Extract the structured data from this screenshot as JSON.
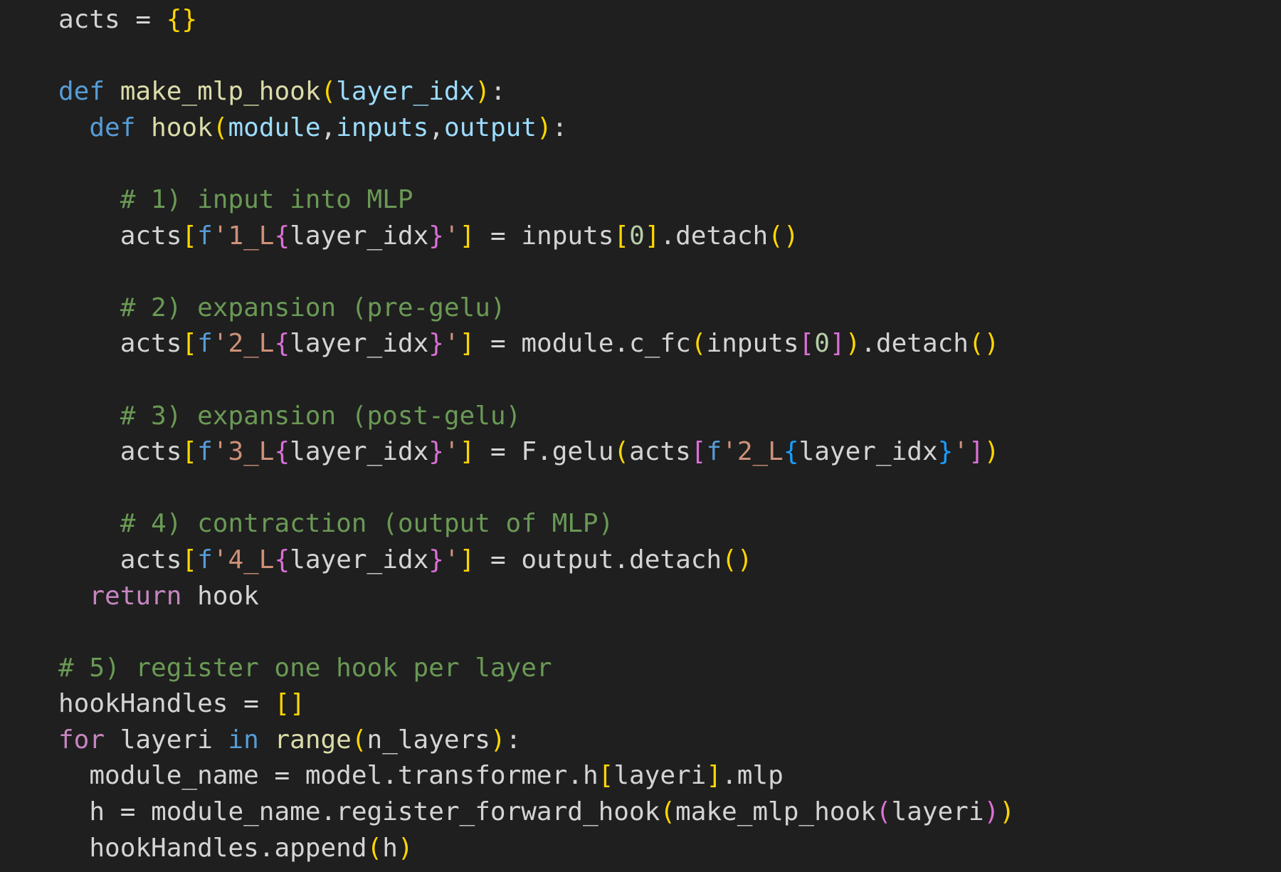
{
  "editor": {
    "language": "python",
    "theme_colors": {
      "background": "#1f1f1f",
      "keyword": "#569cd6",
      "control": "#c586c0",
      "function": "#dcdcaa",
      "parameter": "#9cdcfe",
      "comment": "#6a9955",
      "string": "#ce9178",
      "number": "#b5cea8",
      "bracket_level1": "#ffd700",
      "bracket_level2": "#da70d6",
      "bracket_level3": "#179fff"
    },
    "lines": [
      [
        {
          "t": "acts",
          "c": "var"
        },
        {
          "t": " = ",
          "c": "op"
        },
        {
          "t": "{}",
          "c": "br1"
        }
      ],
      [],
      [
        {
          "t": "def",
          "c": "kw"
        },
        {
          "t": " ",
          "c": "var"
        },
        {
          "t": "make_mlp_hook",
          "c": "fn"
        },
        {
          "t": "(",
          "c": "br1"
        },
        {
          "t": "layer_idx",
          "c": "param"
        },
        {
          "t": ")",
          "c": "br1"
        },
        {
          "t": ":",
          "c": "punc"
        }
      ],
      [
        {
          "t": "  ",
          "c": "var"
        },
        {
          "t": "def",
          "c": "kw"
        },
        {
          "t": " ",
          "c": "var"
        },
        {
          "t": "hook",
          "c": "fn"
        },
        {
          "t": "(",
          "c": "br1"
        },
        {
          "t": "module",
          "c": "param"
        },
        {
          "t": ",",
          "c": "punc"
        },
        {
          "t": "inputs",
          "c": "param"
        },
        {
          "t": ",",
          "c": "punc"
        },
        {
          "t": "output",
          "c": "param"
        },
        {
          "t": ")",
          "c": "br1"
        },
        {
          "t": ":",
          "c": "punc"
        }
      ],
      [],
      [
        {
          "t": "    ",
          "c": "var"
        },
        {
          "t": "# 1) input into MLP",
          "c": "comment"
        }
      ],
      [
        {
          "t": "    ",
          "c": "var"
        },
        {
          "t": "acts",
          "c": "var"
        },
        {
          "t": "[",
          "c": "br1"
        },
        {
          "t": "f",
          "c": "fpre"
        },
        {
          "t": "'1_L",
          "c": "str"
        },
        {
          "t": "{",
          "c": "br2"
        },
        {
          "t": "layer_idx",
          "c": "var"
        },
        {
          "t": "}",
          "c": "br2"
        },
        {
          "t": "'",
          "c": "str"
        },
        {
          "t": "]",
          "c": "br1"
        },
        {
          "t": " = ",
          "c": "op"
        },
        {
          "t": "inputs",
          "c": "var"
        },
        {
          "t": "[",
          "c": "br1"
        },
        {
          "t": "0",
          "c": "num"
        },
        {
          "t": "]",
          "c": "br1"
        },
        {
          "t": ".detach",
          "c": "var"
        },
        {
          "t": "()",
          "c": "br1"
        }
      ],
      [],
      [
        {
          "t": "    ",
          "c": "var"
        },
        {
          "t": "# 2) expansion (pre-gelu)",
          "c": "comment"
        }
      ],
      [
        {
          "t": "    ",
          "c": "var"
        },
        {
          "t": "acts",
          "c": "var"
        },
        {
          "t": "[",
          "c": "br1"
        },
        {
          "t": "f",
          "c": "fpre"
        },
        {
          "t": "'2_L",
          "c": "str"
        },
        {
          "t": "{",
          "c": "br2"
        },
        {
          "t": "layer_idx",
          "c": "var"
        },
        {
          "t": "}",
          "c": "br2"
        },
        {
          "t": "'",
          "c": "str"
        },
        {
          "t": "]",
          "c": "br1"
        },
        {
          "t": " = ",
          "c": "op"
        },
        {
          "t": "module.c_fc",
          "c": "var"
        },
        {
          "t": "(",
          "c": "br1"
        },
        {
          "t": "inputs",
          "c": "var"
        },
        {
          "t": "[",
          "c": "br2"
        },
        {
          "t": "0",
          "c": "num"
        },
        {
          "t": "]",
          "c": "br2"
        },
        {
          "t": ")",
          "c": "br1"
        },
        {
          "t": ".detach",
          "c": "var"
        },
        {
          "t": "()",
          "c": "br1"
        }
      ],
      [],
      [
        {
          "t": "    ",
          "c": "var"
        },
        {
          "t": "# 3) expansion (post-gelu)",
          "c": "comment"
        }
      ],
      [
        {
          "t": "    ",
          "c": "var"
        },
        {
          "t": "acts",
          "c": "var"
        },
        {
          "t": "[",
          "c": "br1"
        },
        {
          "t": "f",
          "c": "fpre"
        },
        {
          "t": "'3_L",
          "c": "str"
        },
        {
          "t": "{",
          "c": "br2"
        },
        {
          "t": "layer_idx",
          "c": "var"
        },
        {
          "t": "}",
          "c": "br2"
        },
        {
          "t": "'",
          "c": "str"
        },
        {
          "t": "]",
          "c": "br1"
        },
        {
          "t": " = ",
          "c": "op"
        },
        {
          "t": "F.gelu",
          "c": "var"
        },
        {
          "t": "(",
          "c": "br1"
        },
        {
          "t": "acts",
          "c": "var"
        },
        {
          "t": "[",
          "c": "br2"
        },
        {
          "t": "f",
          "c": "fpre"
        },
        {
          "t": "'2_L",
          "c": "str"
        },
        {
          "t": "{",
          "c": "br3"
        },
        {
          "t": "layer_idx",
          "c": "var"
        },
        {
          "t": "}",
          "c": "br3"
        },
        {
          "t": "'",
          "c": "str"
        },
        {
          "t": "]",
          "c": "br2"
        },
        {
          "t": ")",
          "c": "br1"
        }
      ],
      [],
      [
        {
          "t": "    ",
          "c": "var"
        },
        {
          "t": "# 4) contraction (output of MLP)",
          "c": "comment"
        }
      ],
      [
        {
          "t": "    ",
          "c": "var"
        },
        {
          "t": "acts",
          "c": "var"
        },
        {
          "t": "[",
          "c": "br1"
        },
        {
          "t": "f",
          "c": "fpre"
        },
        {
          "t": "'4_L",
          "c": "str"
        },
        {
          "t": "{",
          "c": "br2"
        },
        {
          "t": "layer_idx",
          "c": "var"
        },
        {
          "t": "}",
          "c": "br2"
        },
        {
          "t": "'",
          "c": "str"
        },
        {
          "t": "]",
          "c": "br1"
        },
        {
          "t": " = ",
          "c": "op"
        },
        {
          "t": "output.detach",
          "c": "var"
        },
        {
          "t": "()",
          "c": "br1"
        }
      ],
      [
        {
          "t": "  ",
          "c": "var"
        },
        {
          "t": "return",
          "c": "ctl"
        },
        {
          "t": " hook",
          "c": "var"
        }
      ],
      [],
      [
        {
          "t": "# 5) register one hook per layer",
          "c": "comment"
        }
      ],
      [
        {
          "t": "hookHandles",
          "c": "var"
        },
        {
          "t": " = ",
          "c": "op"
        },
        {
          "t": "[]",
          "c": "br1"
        }
      ],
      [
        {
          "t": "for",
          "c": "ctl"
        },
        {
          "t": " layeri ",
          "c": "var"
        },
        {
          "t": "in",
          "c": "kw"
        },
        {
          "t": " ",
          "c": "var"
        },
        {
          "t": "range",
          "c": "fn"
        },
        {
          "t": "(",
          "c": "br1"
        },
        {
          "t": "n_layers",
          "c": "var"
        },
        {
          "t": ")",
          "c": "br1"
        },
        {
          "t": ":",
          "c": "punc"
        }
      ],
      [
        {
          "t": "  ",
          "c": "var"
        },
        {
          "t": "module_name",
          "c": "var"
        },
        {
          "t": " = ",
          "c": "op"
        },
        {
          "t": "model.transformer.h",
          "c": "var"
        },
        {
          "t": "[",
          "c": "br1"
        },
        {
          "t": "layeri",
          "c": "var"
        },
        {
          "t": "]",
          "c": "br1"
        },
        {
          "t": ".mlp",
          "c": "var"
        }
      ],
      [
        {
          "t": "  ",
          "c": "var"
        },
        {
          "t": "h",
          "c": "var"
        },
        {
          "t": " = ",
          "c": "op"
        },
        {
          "t": "module_name.register_forward_hook",
          "c": "var"
        },
        {
          "t": "(",
          "c": "br1"
        },
        {
          "t": "make_mlp_hook",
          "c": "var"
        },
        {
          "t": "(",
          "c": "br2"
        },
        {
          "t": "layeri",
          "c": "var"
        },
        {
          "t": ")",
          "c": "br2"
        },
        {
          "t": ")",
          "c": "br1"
        }
      ],
      [
        {
          "t": "  ",
          "c": "var"
        },
        {
          "t": "hookHandles.append",
          "c": "var"
        },
        {
          "t": "(",
          "c": "br1"
        },
        {
          "t": "h",
          "c": "var"
        },
        {
          "t": ")",
          "c": "br1"
        }
      ]
    ]
  }
}
